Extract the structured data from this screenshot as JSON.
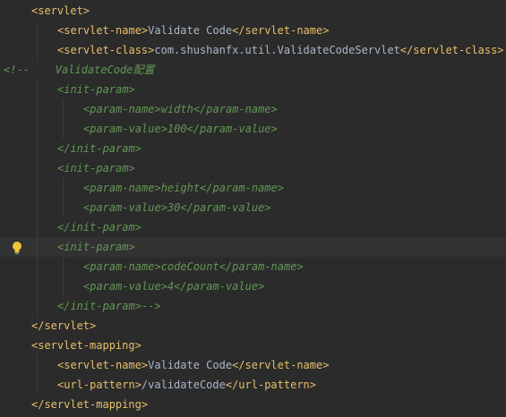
{
  "editor": {
    "lines": [
      {
        "indent": 0,
        "segments": [
          {
            "t": "<servlet>",
            "c": "tag"
          }
        ]
      },
      {
        "indent": 1,
        "segments": [
          {
            "t": "<servlet-name>",
            "c": "tag"
          },
          {
            "t": "Validate Code",
            "c": "plain"
          },
          {
            "t": "</servlet-name>",
            "c": "tag"
          }
        ]
      },
      {
        "indent": 1,
        "segments": [
          {
            "t": "<servlet-class>",
            "c": "tag"
          },
          {
            "t": "com.shushanfx.util.ValidateCodeServlet",
            "c": "plain"
          },
          {
            "t": "</servlet-class>",
            "c": "tag"
          }
        ]
      },
      {
        "indent": 0,
        "comment_start": true,
        "segments": [
          {
            "t": "<!--",
            "c": "comment-mark"
          },
          {
            "t": "    ValidateCode配置",
            "c": "comment"
          }
        ]
      },
      {
        "indent": 1,
        "segments": [
          {
            "t": "<init-param>",
            "c": "comment"
          }
        ]
      },
      {
        "indent": 2,
        "segments": [
          {
            "t": "<param-name>",
            "c": "comment"
          },
          {
            "t": "width",
            "c": "comment"
          },
          {
            "t": "</param-name>",
            "c": "comment"
          }
        ]
      },
      {
        "indent": 2,
        "segments": [
          {
            "t": "<param-value>",
            "c": "comment"
          },
          {
            "t": "100",
            "c": "comment"
          },
          {
            "t": "</param-value>",
            "c": "comment"
          }
        ]
      },
      {
        "indent": 1,
        "segments": [
          {
            "t": "</init-param>",
            "c": "comment"
          }
        ]
      },
      {
        "indent": 1,
        "segments": [
          {
            "t": "<init-param>",
            "c": "comment"
          }
        ]
      },
      {
        "indent": 2,
        "segments": [
          {
            "t": "<param-name>",
            "c": "comment"
          },
          {
            "t": "height",
            "c": "comment"
          },
          {
            "t": "</param-name>",
            "c": "comment"
          }
        ]
      },
      {
        "indent": 2,
        "segments": [
          {
            "t": "<param-value>",
            "c": "comment"
          },
          {
            "t": "30",
            "c": "comment"
          },
          {
            "t": "</param-value>",
            "c": "comment"
          }
        ]
      },
      {
        "indent": 1,
        "segments": [
          {
            "t": "</init-param>",
            "c": "comment"
          }
        ]
      },
      {
        "indent": 1,
        "current": true,
        "bulb": true,
        "segments": [
          {
            "t": "<init-param>",
            "c": "comment"
          }
        ]
      },
      {
        "indent": 2,
        "segments": [
          {
            "t": "<param-name>",
            "c": "comment"
          },
          {
            "t": "codeCount",
            "c": "comment"
          },
          {
            "t": "</param-name>",
            "c": "comment"
          }
        ]
      },
      {
        "indent": 2,
        "segments": [
          {
            "t": "<param-value>",
            "c": "comment"
          },
          {
            "t": "4",
            "c": "comment"
          },
          {
            "t": "</param-value>",
            "c": "comment"
          }
        ]
      },
      {
        "indent": 1,
        "segments": [
          {
            "t": "</init-param>",
            "c": "comment"
          },
          {
            "t": "-->",
            "c": "comment-mark"
          }
        ]
      },
      {
        "indent": 0,
        "segments": [
          {
            "t": "</servlet>",
            "c": "tag"
          }
        ]
      },
      {
        "indent": 0,
        "segments": [
          {
            "t": "<servlet-mapping>",
            "c": "tag"
          }
        ]
      },
      {
        "indent": 1,
        "segments": [
          {
            "t": "<servlet-name>",
            "c": "tag"
          },
          {
            "t": "Validate Code",
            "c": "plain"
          },
          {
            "t": "</servlet-name>",
            "c": "tag"
          }
        ]
      },
      {
        "indent": 1,
        "segments": [
          {
            "t": "<url-pattern>",
            "c": "tag"
          },
          {
            "t": "/validateCode",
            "c": "plain"
          },
          {
            "t": "</url-pattern>",
            "c": "tag"
          }
        ]
      },
      {
        "indent": 0,
        "segments": [
          {
            "t": "</servlet-mapping>",
            "c": "tag"
          }
        ]
      }
    ],
    "icons": {
      "bulb": "lightbulb-icon"
    },
    "colors": {
      "background": "#2b2b2b",
      "current_line": "#323232",
      "tag": "#e8bf6a",
      "text": "#a9b7c6",
      "comment": "#629755",
      "bulb": "#f0c537"
    }
  }
}
